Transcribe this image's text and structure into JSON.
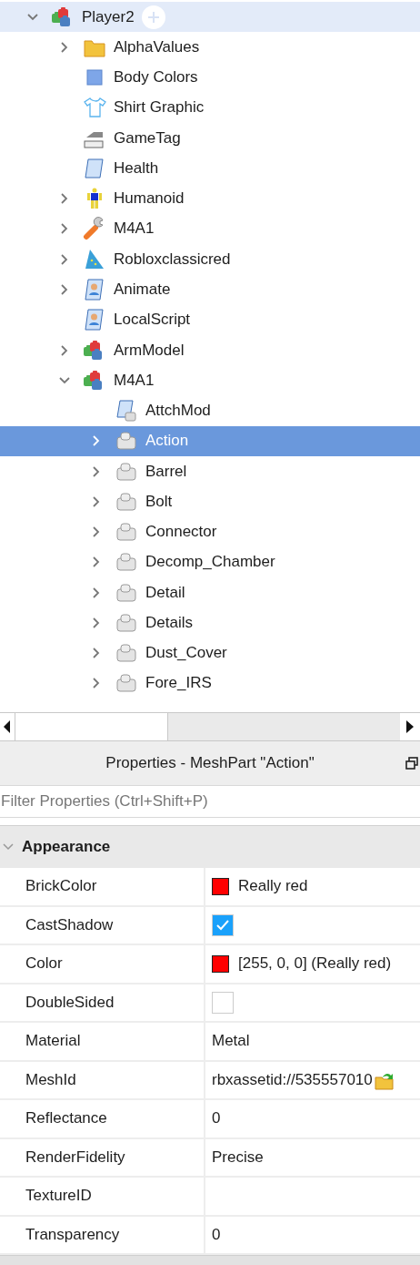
{
  "explorer": {
    "items": [
      {
        "label": "Player2",
        "kind": "model",
        "expandable": true,
        "expanded": true,
        "selected": false,
        "hovered": true,
        "children": [
          {
            "label": "AlphaValues",
            "kind": "folder",
            "expandable": true,
            "expanded": false,
            "selected": false,
            "hovered": false
          },
          {
            "label": "Body Colors",
            "kind": "bodycolors",
            "expandable": false,
            "selected": false,
            "hovered": false
          },
          {
            "label": "Shirt Graphic",
            "kind": "shirt",
            "expandable": false,
            "selected": false,
            "hovered": false
          },
          {
            "label": "GameTag",
            "kind": "value",
            "expandable": false,
            "selected": false,
            "hovered": false
          },
          {
            "label": "Health",
            "kind": "script",
            "expandable": false,
            "selected": false,
            "hovered": false
          },
          {
            "label": "Humanoid",
            "kind": "humanoid",
            "expandable": true,
            "expanded": false,
            "selected": false,
            "hovered": false
          },
          {
            "label": "M4A1",
            "kind": "tool",
            "expandable": true,
            "expanded": false,
            "selected": false,
            "hovered": false
          },
          {
            "label": "Robloxclassicred",
            "kind": "hat",
            "expandable": true,
            "expanded": false,
            "selected": false,
            "hovered": false
          },
          {
            "label": "Animate",
            "kind": "localscript",
            "expandable": true,
            "expanded": false,
            "selected": false,
            "hovered": false
          },
          {
            "label": "LocalScript",
            "kind": "localscript",
            "expandable": false,
            "selected": false,
            "hovered": false
          },
          {
            "label": "ArmModel",
            "kind": "model",
            "expandable": true,
            "expanded": false,
            "selected": false,
            "hovered": false
          },
          {
            "label": "M4A1",
            "kind": "model",
            "expandable": true,
            "expanded": true,
            "selected": false,
            "hovered": false,
            "children": [
              {
                "label": "AttchMod",
                "kind": "modulescript",
                "expandable": false,
                "selected": false,
                "hovered": false
              },
              {
                "label": "Action",
                "kind": "meshpart",
                "expandable": true,
                "expanded": false,
                "selected": true,
                "hovered": false
              },
              {
                "label": "Barrel",
                "kind": "meshpart",
                "expandable": true,
                "expanded": false,
                "selected": false,
                "hovered": false
              },
              {
                "label": "Bolt",
                "kind": "meshpart",
                "expandable": true,
                "expanded": false,
                "selected": false,
                "hovered": false
              },
              {
                "label": "Connector",
                "kind": "meshpart",
                "expandable": true,
                "expanded": false,
                "selected": false,
                "hovered": false
              },
              {
                "label": "Decomp_Chamber",
                "kind": "meshpart",
                "expandable": true,
                "expanded": false,
                "selected": false,
                "hovered": false
              },
              {
                "label": "Detail",
                "kind": "meshpart",
                "expandable": true,
                "expanded": false,
                "selected": false,
                "hovered": false
              },
              {
                "label": "Details",
                "kind": "meshpart",
                "expandable": true,
                "expanded": false,
                "selected": false,
                "hovered": false
              },
              {
                "label": "Dust_Cover",
                "kind": "meshpart",
                "expandable": true,
                "expanded": false,
                "selected": false,
                "hovered": false
              },
              {
                "label": "Fore_IRS",
                "kind": "meshpart",
                "expandable": true,
                "expanded": false,
                "selected": false,
                "hovered": false
              }
            ]
          }
        ]
      }
    ]
  },
  "properties": {
    "title": "Properties - MeshPart \"Action\"",
    "filter": {
      "placeholder": "Filter Properties (Ctrl+Shift+P)"
    },
    "sections": [
      {
        "title": "Appearance",
        "expanded": true,
        "rows": [
          {
            "name": "BrickColor",
            "kind": "color",
            "color": "#ff0000",
            "value": "Really red"
          },
          {
            "name": "CastShadow",
            "kind": "checkbox",
            "checked": true
          },
          {
            "name": "Color",
            "kind": "color",
            "color": "#ff0000",
            "value": "[255, 0, 0] (Really red)"
          },
          {
            "name": "DoubleSided",
            "kind": "checkbox",
            "checked": false
          },
          {
            "name": "Material",
            "kind": "text",
            "value": "Metal"
          },
          {
            "name": "MeshId",
            "kind": "asset",
            "value": "rbxassetid://535557010"
          },
          {
            "name": "Reflectance",
            "kind": "text",
            "value": "0"
          },
          {
            "name": "RenderFidelity",
            "kind": "text",
            "value": "Precise"
          },
          {
            "name": "TextureID",
            "kind": "text"
          },
          {
            "name": "Transparency",
            "kind": "text",
            "value": "0"
          }
        ]
      }
    ]
  }
}
